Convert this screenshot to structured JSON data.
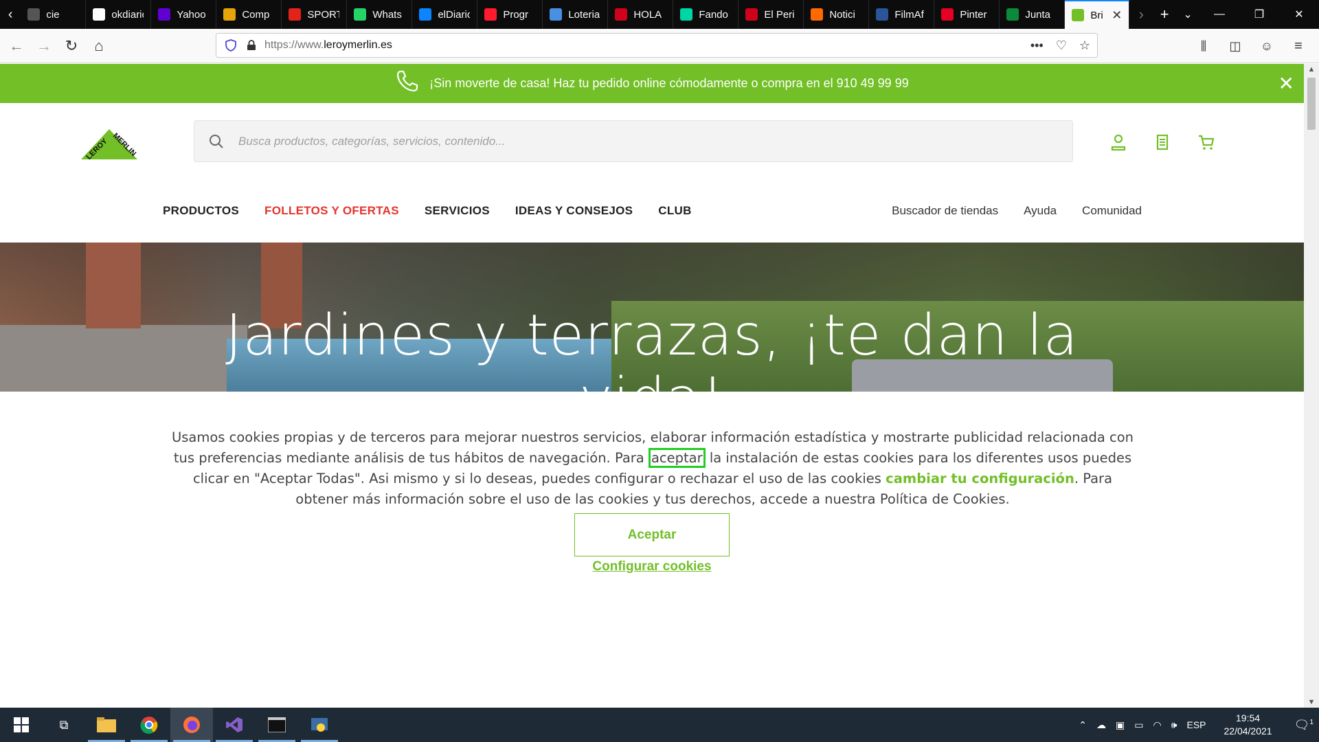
{
  "browser": {
    "tabs": [
      {
        "label": "cie",
        "icon": "generic-page-icon",
        "color": "#555555"
      },
      {
        "label": "okdiario",
        "icon": "okdiario-icon",
        "color": "#ffffff"
      },
      {
        "label": "Yahoo",
        "icon": "yahoo-icon",
        "color": "#6001d2"
      },
      {
        "label": "Comp",
        "icon": "bars-icon",
        "color": "#e5a50a"
      },
      {
        "label": "SPORT",
        "icon": "sport-icon",
        "color": "#e2231a"
      },
      {
        "label": "Whats",
        "icon": "whatsapp-icon",
        "color": "#25d366"
      },
      {
        "label": "elDiario",
        "icon": "eldiario-icon",
        "color": "#0a84ff"
      },
      {
        "label": "Progr",
        "icon": "opera-icon",
        "color": "#ff1b2d"
      },
      {
        "label": "Loteria",
        "icon": "loteria-icon",
        "color": "#4a90e2"
      },
      {
        "label": "HOLA",
        "icon": "hola-icon",
        "color": "#d0021b"
      },
      {
        "label": "Fando",
        "icon": "fandom-icon",
        "color": "#00d6a3"
      },
      {
        "label": "El Peri",
        "icon": "elperiodico-icon",
        "color": "#d0021b"
      },
      {
        "label": "Notici",
        "icon": "rtve-icon",
        "color": "#ff6a00"
      },
      {
        "label": "FilmAf",
        "icon": "filmaffinity-icon",
        "color": "#2a5599"
      },
      {
        "label": "Pinter",
        "icon": "pinterest-icon",
        "color": "#e60023"
      },
      {
        "label": "Junta",
        "icon": "junta-icon",
        "color": "#0b8a3b"
      },
      {
        "label": "Bri",
        "icon": "leroy-tab-icon",
        "color": "#72bf27",
        "active": true
      }
    ],
    "url_prefix": "https://www.",
    "url_domain": "leroymerlin.es",
    "colors": {
      "accent": "#0a84ff"
    }
  },
  "promo": {
    "text": "¡Sin moverte de casa! Haz tu pedido online cómodamente o compra en el 910 49 99 99",
    "close": "✕"
  },
  "header": {
    "logo_text": "LEROY MERLIN",
    "search_placeholder": "Busca productos, categorías, servicios, contenido..."
  },
  "nav": {
    "left": [
      {
        "label": "PRODUCTOS",
        "highlight": false
      },
      {
        "label": "FOLLETOS Y OFERTAS",
        "highlight": true
      },
      {
        "label": "SERVICIOS",
        "highlight": false
      },
      {
        "label": "IDEAS Y CONSEJOS",
        "highlight": false
      },
      {
        "label": "CLUB",
        "highlight": false
      }
    ],
    "right": [
      "Buscador de tiendas",
      "Ayuda",
      "Comunidad"
    ]
  },
  "hero": {
    "title_line1": "Jardines y terrazas, ¡te dan la",
    "title_line2": "vida!"
  },
  "cookie": {
    "part1": "Usamos cookies propias y de terceros para mejorar nuestros servicios, elaborar información estadística y mostrarte publicidad relacionada con tus preferencias mediante análisis de tus hábitos de navegación. Para ",
    "highlight_word": "aceptar",
    "part2": " la instalación de estas cookies para los diferentes usos puedes clicar en \"Aceptar Todas\". Asi mismo y si lo deseas, puedes configurar o rechazar el uso  de las cookies ",
    "config_link": "cambiar tu configuración",
    "part3": ". Para obtener más información sobre el uso de las cookies y tus derechos, accede a nuestra Política de Cookies.",
    "accept_button": "Aceptar",
    "configure_link": "Configurar cookies",
    "colors": {
      "brand_green": "#72bf27",
      "focus_box": "#22cc22"
    }
  },
  "taskbar": {
    "language": "ESP",
    "time": "19:54",
    "date": "22/04/2021",
    "notifications": "1"
  }
}
